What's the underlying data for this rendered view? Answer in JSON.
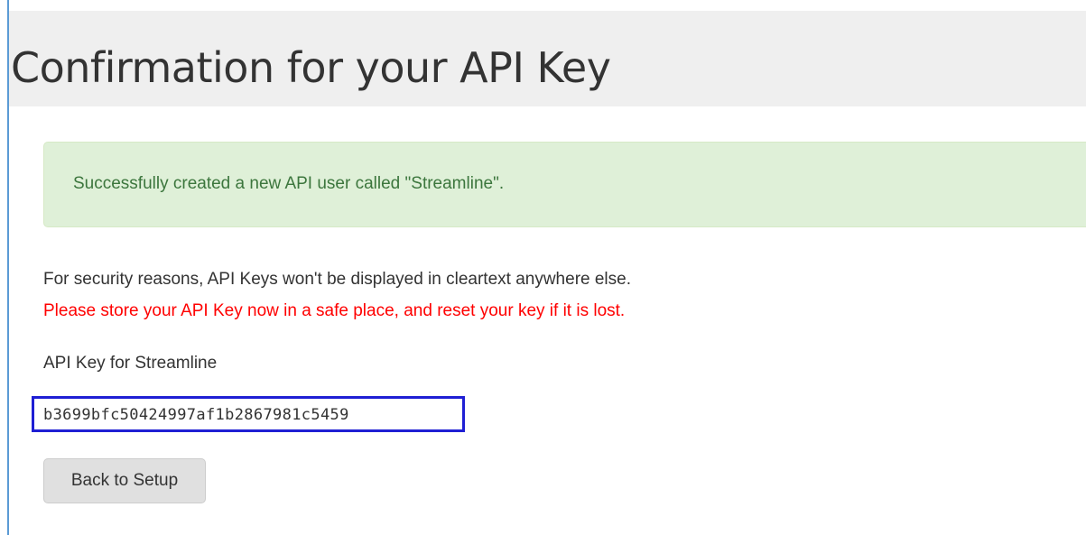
{
  "page": {
    "title": "Confirmation for your API Key"
  },
  "alert": {
    "message": "Successfully created a new API user called \"Streamline\".",
    "color": "#dff0d8"
  },
  "security_notice": {
    "line1": "For security reasons, API Keys won't be displayed in cleartext anywhere else.",
    "line2": "Please store your API Key now in a safe place, and reset your key if it is lost.",
    "line2_color": "#ff0000"
  },
  "api_key": {
    "label": "API Key for Streamline",
    "value": "b3699bfc50424997af1b2867981c5459",
    "highlight_color": "#1f1fd4"
  },
  "actions": {
    "back_label": "Back to Setup"
  }
}
